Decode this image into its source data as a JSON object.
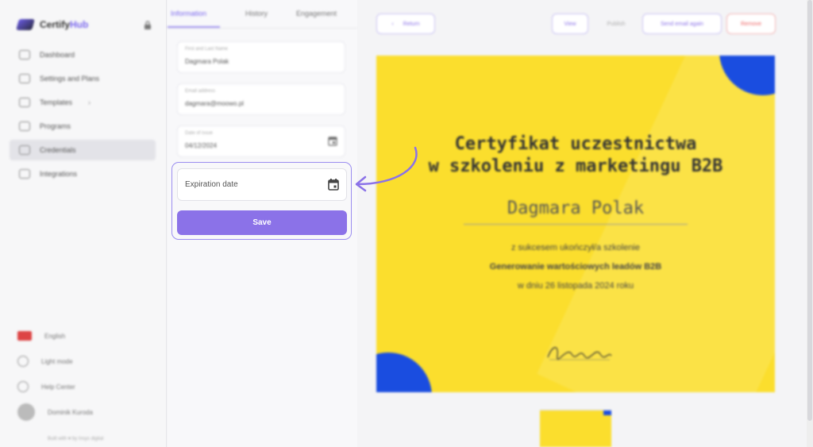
{
  "app": {
    "logo_text": "Certify",
    "logo_accent": "Hub"
  },
  "sidebar": {
    "items": [
      {
        "label": "Dashboard"
      },
      {
        "label": "Settings and Plans"
      },
      {
        "label": "Templates"
      },
      {
        "label": "Programs"
      },
      {
        "label": "Credentials"
      },
      {
        "label": "Integrations"
      }
    ],
    "bottom": {
      "language": "English",
      "theme": "Light mode",
      "help": "Help Center",
      "user": "Dominik Kuroda"
    },
    "footer": "Built with ♥ by Insys digital"
  },
  "tabs": {
    "information": "Information",
    "history": "History",
    "engagement": "Engagement"
  },
  "form": {
    "name_label": "First and Last Name",
    "name_value": "Dagmara Polak",
    "email_label": "Email address",
    "email_value": "dagmara@moowo.pl",
    "issue_label": "Date of issue",
    "issue_value": "04/12/2024",
    "expiration_placeholder": "Expiration date",
    "save_label": "Save"
  },
  "preview": {
    "return_label": "Return",
    "view_label": "View",
    "publish_label": "Publish",
    "send_label": "Send email again",
    "remove_label": "Remove"
  },
  "certificate": {
    "title_line1": "Certyfikat uczestnictwa",
    "title_line2": "w szkoleniu z marketingu B2B",
    "recipient": "Dagmara Polak",
    "completed": "z sukcesem ukończył/a szkolenie",
    "course": "Generowanie wartościowych leadów B2B",
    "date_line": "w dniu 26 listopada 2024 roku"
  },
  "colors": {
    "accent": "#8b72e8",
    "cert_bg": "#fbde2d",
    "cert_corner": "#1a4de0",
    "remove": "#e66"
  }
}
